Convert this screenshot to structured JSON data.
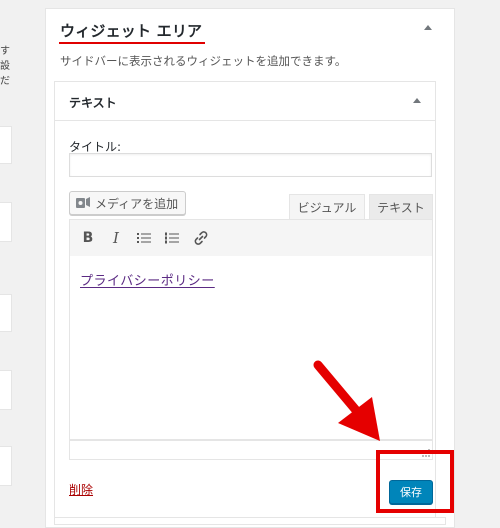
{
  "left_fragments": [
    "す",
    "設",
    "だ"
  ],
  "widget_area": {
    "title": "ウィジェット エリア",
    "description": "サイドバーに表示されるウィジェットを追加できます。"
  },
  "text_widget": {
    "title": "テキスト",
    "title_field_label": "タイトル:",
    "title_field_value": "",
    "add_media_label": "メディアを追加",
    "tabs": [
      "ビジュアル",
      "テキスト"
    ],
    "active_tab": "ビジュアル",
    "toolbar": [
      "bold-icon",
      "italic-icon",
      "bulleted-list-icon",
      "numbered-list-icon",
      "link-icon"
    ],
    "editor_content": "プライバシーポリシー",
    "delete_label": "削除",
    "save_label": "保存"
  },
  "colors": {
    "primary_button": "#0085ba",
    "annotation_red": "#e50000",
    "link_visited": "#5b2a83",
    "delete_red": "#aa0000"
  }
}
